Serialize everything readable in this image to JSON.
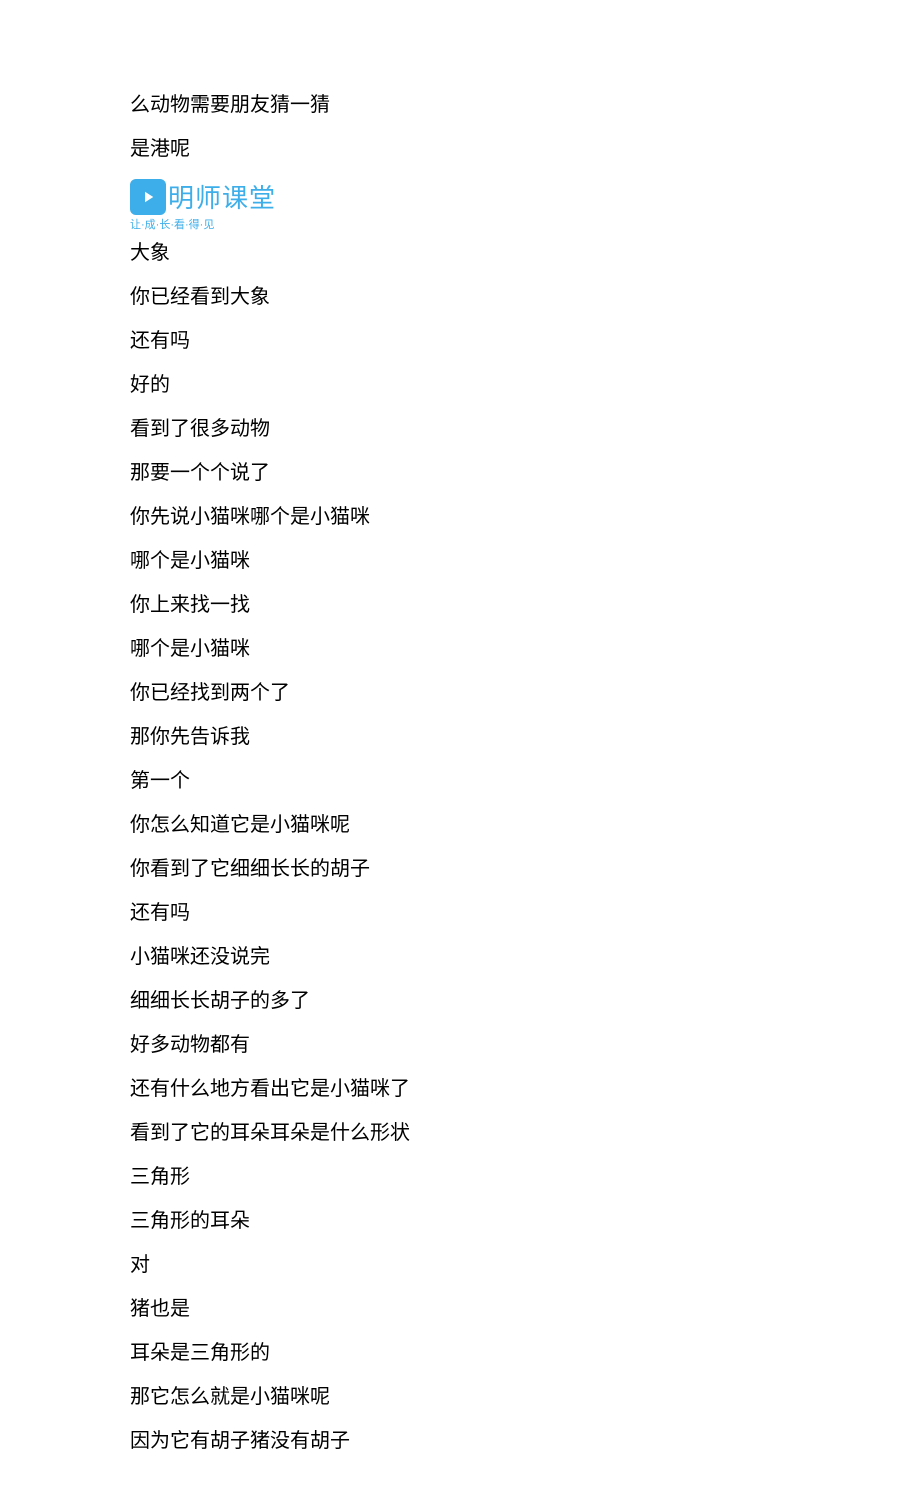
{
  "lines": [
    "么动物需要朋友猜一猜",
    "是港呢"
  ],
  "logo": {
    "brand": "明师课堂",
    "tagline": "让·成·长·看·得·见"
  },
  "lines2": [
    "大象",
    "你已经看到大象",
    "还有吗",
    "好的",
    "看到了很多动物",
    "那要一个个说了",
    "你先说小猫咪哪个是小猫咪",
    "哪个是小猫咪",
    "你上来找一找",
    "哪个是小猫咪",
    "你已经找到两个了",
    "那你先告诉我",
    "第一个",
    "你怎么知道它是小猫咪呢",
    "你看到了它细细长长的胡子",
    "还有吗",
    "小猫咪还没说完",
    "细细长长胡子的多了",
    "好多动物都有",
    "还有什么地方看出它是小猫咪了",
    "看到了它的耳朵耳朵是什么形状",
    "三角形",
    "三角形的耳朵",
    "对",
    "猪也是",
    "耳朵是三角形的",
    "那它怎么就是小猫咪呢",
    "因为它有胡子猪没有胡子"
  ]
}
